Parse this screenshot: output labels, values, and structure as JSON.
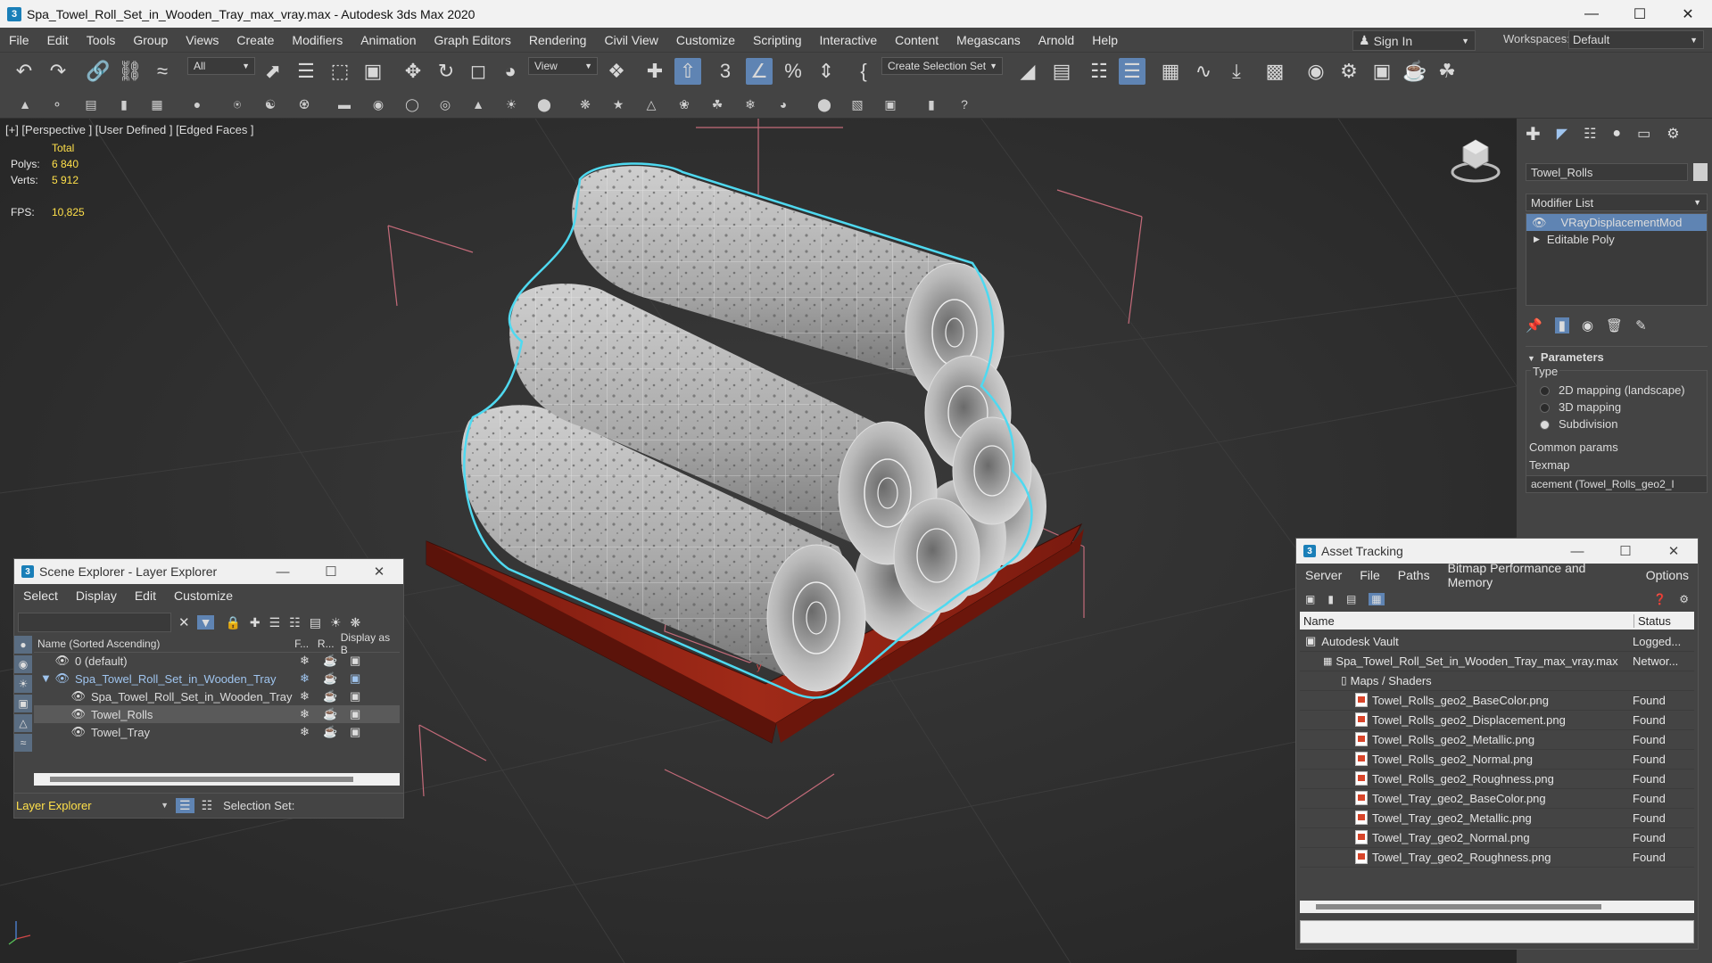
{
  "titlebar": {
    "title": "Spa_Towel_Roll_Set_in_Wooden_Tray_max_vray.max - Autodesk 3ds Max 2020",
    "icon": "3"
  },
  "menu": [
    "File",
    "Edit",
    "Tools",
    "Group",
    "Views",
    "Create",
    "Modifiers",
    "Animation",
    "Graph Editors",
    "Rendering",
    "Civil View",
    "Customize",
    "Scripting",
    "Interactive",
    "Content",
    "Megascans",
    "Arnold",
    "Help"
  ],
  "account": {
    "signin": "Sign In",
    "workspaces_label": "Workspaces:",
    "workspace": "Default"
  },
  "toolbar": {
    "filter": "All",
    "ref_coord": "View",
    "selection_set": "Create Selection Set",
    "snap": "3"
  },
  "viewport": {
    "label": "[+] [Perspective ] [User Defined ] [Edged Faces ]",
    "stats": {
      "total": "Total",
      "polys_label": "Polys:",
      "polys": "6 840",
      "verts_label": "Verts:",
      "verts": "5 912",
      "fps_label": "FPS:",
      "fps": "10,825"
    },
    "axis": {
      "y": "y",
      "z": "z",
      "x": "x"
    }
  },
  "command_panel": {
    "object_name": "Towel_Rolls",
    "modifier_list": "Modifier List",
    "stack": [
      "VRayDisplacementMod",
      "Editable Poly"
    ],
    "rollout": "Parameters",
    "type_label": "Type",
    "types": [
      "2D mapping (landscape)",
      "3D mapping",
      "Subdivision"
    ],
    "selected_type": "Subdivision",
    "common_params": "Common params",
    "texmap_label": "Texmap",
    "texmap_value": "acement (Towel_Rolls_geo2_I"
  },
  "scene_explorer": {
    "title": "Scene Explorer - Layer Explorer",
    "menu": [
      "Select",
      "Display",
      "Edit",
      "Customize"
    ],
    "columns": [
      "Name (Sorted Ascending)",
      "F...",
      "R...",
      "Display as B"
    ],
    "rows": [
      "0 (default)",
      "Spa_Towel_Roll_Set_in_Wooden_Tray",
      "Spa_Towel_Roll_Set_in_Wooden_Tray",
      "Towel_Rolls",
      "Towel_Tray"
    ],
    "footer_mode": "Layer Explorer",
    "selection_set_label": "Selection Set:"
  },
  "asset_tracking": {
    "title": "Asset Tracking",
    "menu": [
      "Server",
      "File",
      "Paths",
      "Bitmap Performance and Memory",
      "Options"
    ],
    "columns": [
      "Name",
      "Status"
    ],
    "vault": {
      "name": "Autodesk Vault",
      "status": "Logged..."
    },
    "scene_file": {
      "name": "Spa_Towel_Roll_Set_in_Wooden_Tray_max_vray.max",
      "status": "Networ..."
    },
    "folder": "Maps / Shaders",
    "files": [
      {
        "name": "Towel_Rolls_geo2_BaseColor.png",
        "status": "Found"
      },
      {
        "name": "Towel_Rolls_geo2_Displacement.png",
        "status": "Found"
      },
      {
        "name": "Towel_Rolls_geo2_Metallic.png",
        "status": "Found"
      },
      {
        "name": "Towel_Rolls_geo2_Normal.png",
        "status": "Found"
      },
      {
        "name": "Towel_Rolls_geo2_Roughness.png",
        "status": "Found"
      },
      {
        "name": "Towel_Tray_geo2_BaseColor.png",
        "status": "Found"
      },
      {
        "name": "Towel_Tray_geo2_Metallic.png",
        "status": "Found"
      },
      {
        "name": "Towel_Tray_geo2_Normal.png",
        "status": "Found"
      },
      {
        "name": "Towel_Tray_geo2_Roughness.png",
        "status": "Found"
      }
    ]
  },
  "colors": {
    "accent": "#5f84b3",
    "selection_outline": "#4fd9f0",
    "stats_yellow": "#ffe04a",
    "tray_red": "#8a1c12"
  }
}
